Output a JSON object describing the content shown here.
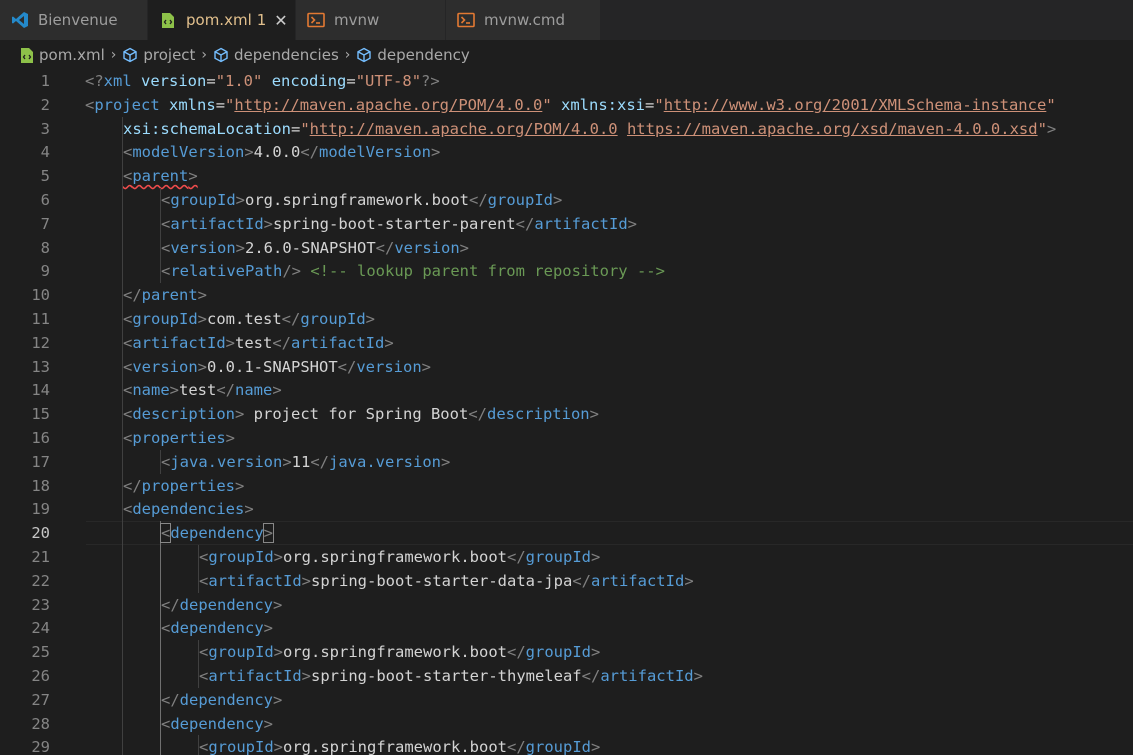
{
  "tabs": [
    {
      "name": "tab-bienvenue",
      "icon": "vscode-icon",
      "label": "Bienvenue",
      "active": false,
      "badge": "",
      "close": false,
      "width": 148
    },
    {
      "name": "tab-pom-xml",
      "icon": "xml-file-icon",
      "label": "pom.xml",
      "active": true,
      "badge": "1",
      "close": true,
      "width": 148
    },
    {
      "name": "tab-mvnw",
      "icon": "terminal-file-icon",
      "label": "mvnw",
      "active": false,
      "badge": "",
      "close": false,
      "width": 150
    },
    {
      "name": "tab-mvnw-cmd",
      "icon": "terminal-file-icon",
      "label": "mvnw.cmd",
      "active": false,
      "badge": "",
      "close": false,
      "width": 155
    }
  ],
  "breadcrumb": [
    {
      "icon": "xml-file-icon",
      "label": "pom.xml"
    },
    {
      "icon": "xml-element-icon",
      "label": "project"
    },
    {
      "icon": "xml-element-icon",
      "label": "dependencies"
    },
    {
      "icon": "xml-element-icon",
      "label": "dependency"
    }
  ],
  "colors": {
    "background": "#1e1e1e",
    "tag": "#569cd6",
    "attribute": "#9cdcfe",
    "string": "#ce9178",
    "comment": "#6a9955",
    "punctuation": "#808080",
    "text": "#d4d4d4",
    "modified_tab": "#e2c08d"
  },
  "editor": {
    "current_line": 20,
    "lines": [
      {
        "n": "1",
        "indent": 0,
        "tokens": [
          [
            "p",
            "<?"
          ],
          [
            "t",
            "xml"
          ],
          [
            "s",
            " "
          ],
          [
            "a",
            "version"
          ],
          [
            "x",
            "="
          ],
          [
            "s",
            "\"1.0\""
          ],
          [
            "x",
            " "
          ],
          [
            "a",
            "encoding"
          ],
          [
            "x",
            "="
          ],
          [
            "s",
            "\"UTF-8\""
          ],
          [
            "p",
            "?>"
          ]
        ]
      },
      {
        "n": "2",
        "indent": 0,
        "tokens": [
          [
            "p",
            "<"
          ],
          [
            "t",
            "project"
          ],
          [
            "x",
            " "
          ],
          [
            "a",
            "xmlns"
          ],
          [
            "x",
            "="
          ],
          [
            "s",
            "\""
          ],
          [
            "su",
            "http://maven.apache.org/POM/4.0.0"
          ],
          [
            "s",
            "\""
          ],
          [
            "x",
            " "
          ],
          [
            "a",
            "xmlns:xsi"
          ],
          [
            "x",
            "="
          ],
          [
            "s",
            "\""
          ],
          [
            "su",
            "http://www.w3.org/2001/XMLSchema-instance"
          ],
          [
            "s",
            "\""
          ]
        ]
      },
      {
        "n": "3",
        "indent": 1,
        "tokens": [
          [
            "a",
            "xsi:schemaLocation"
          ],
          [
            "x",
            "="
          ],
          [
            "s",
            "\""
          ],
          [
            "su",
            "http://maven.apache.org/POM/4.0.0"
          ],
          [
            "s",
            " "
          ],
          [
            "su",
            "https://maven.apache.org/xsd/maven-4.0.0.xsd"
          ],
          [
            "s",
            "\""
          ],
          [
            "p",
            ">"
          ]
        ]
      },
      {
        "n": "4",
        "indent": 1,
        "tokens": [
          [
            "p",
            "<"
          ],
          [
            "t",
            "modelVersion"
          ],
          [
            "p",
            ">"
          ],
          [
            "x",
            "4.0.0"
          ],
          [
            "p",
            "</"
          ],
          [
            "t",
            "modelVersion"
          ],
          [
            "p",
            ">"
          ]
        ]
      },
      {
        "n": "5",
        "indent": 1,
        "tokens": [
          [
            "pe",
            "<"
          ],
          [
            "te",
            "parent"
          ],
          [
            "pe",
            ">"
          ]
        ]
      },
      {
        "n": "6",
        "indent": 2,
        "tokens": [
          [
            "p",
            "<"
          ],
          [
            "t",
            "groupId"
          ],
          [
            "p",
            ">"
          ],
          [
            "x",
            "org.springframework.boot"
          ],
          [
            "p",
            "</"
          ],
          [
            "t",
            "groupId"
          ],
          [
            "p",
            ">"
          ]
        ]
      },
      {
        "n": "7",
        "indent": 2,
        "tokens": [
          [
            "p",
            "<"
          ],
          [
            "t",
            "artifactId"
          ],
          [
            "p",
            ">"
          ],
          [
            "x",
            "spring-boot-starter-parent"
          ],
          [
            "p",
            "</"
          ],
          [
            "t",
            "artifactId"
          ],
          [
            "p",
            ">"
          ]
        ]
      },
      {
        "n": "8",
        "indent": 2,
        "tokens": [
          [
            "p",
            "<"
          ],
          [
            "t",
            "version"
          ],
          [
            "p",
            ">"
          ],
          [
            "x",
            "2.6.0-SNAPSHOT"
          ],
          [
            "p",
            "</"
          ],
          [
            "t",
            "version"
          ],
          [
            "p",
            ">"
          ]
        ]
      },
      {
        "n": "9",
        "indent": 2,
        "tokens": [
          [
            "p",
            "<"
          ],
          [
            "t",
            "relativePath"
          ],
          [
            "p",
            "/>"
          ],
          [
            "x",
            " "
          ],
          [
            "c",
            "<!-- lookup parent from repository -->"
          ]
        ]
      },
      {
        "n": "10",
        "indent": 1,
        "tokens": [
          [
            "p",
            "</"
          ],
          [
            "t",
            "parent"
          ],
          [
            "p",
            ">"
          ]
        ]
      },
      {
        "n": "11",
        "indent": 1,
        "tokens": [
          [
            "p",
            "<"
          ],
          [
            "t",
            "groupId"
          ],
          [
            "p",
            ">"
          ],
          [
            "x",
            "com.test"
          ],
          [
            "p",
            "</"
          ],
          [
            "t",
            "groupId"
          ],
          [
            "p",
            ">"
          ]
        ]
      },
      {
        "n": "12",
        "indent": 1,
        "tokens": [
          [
            "p",
            "<"
          ],
          [
            "t",
            "artifactId"
          ],
          [
            "p",
            ">"
          ],
          [
            "x",
            "test"
          ],
          [
            "p",
            "</"
          ],
          [
            "t",
            "artifactId"
          ],
          [
            "p",
            ">"
          ]
        ]
      },
      {
        "n": "13",
        "indent": 1,
        "tokens": [
          [
            "p",
            "<"
          ],
          [
            "t",
            "version"
          ],
          [
            "p",
            ">"
          ],
          [
            "x",
            "0.0.1-SNAPSHOT"
          ],
          [
            "p",
            "</"
          ],
          [
            "t",
            "version"
          ],
          [
            "p",
            ">"
          ]
        ]
      },
      {
        "n": "14",
        "indent": 1,
        "tokens": [
          [
            "p",
            "<"
          ],
          [
            "t",
            "name"
          ],
          [
            "p",
            ">"
          ],
          [
            "x",
            "test"
          ],
          [
            "p",
            "</"
          ],
          [
            "t",
            "name"
          ],
          [
            "p",
            ">"
          ]
        ]
      },
      {
        "n": "15",
        "indent": 1,
        "tokens": [
          [
            "p",
            "<"
          ],
          [
            "t",
            "description"
          ],
          [
            "p",
            ">"
          ],
          [
            "x",
            " project for Spring Boot"
          ],
          [
            "p",
            "</"
          ],
          [
            "t",
            "description"
          ],
          [
            "p",
            ">"
          ]
        ]
      },
      {
        "n": "16",
        "indent": 1,
        "tokens": [
          [
            "p",
            "<"
          ],
          [
            "t",
            "properties"
          ],
          [
            "p",
            ">"
          ]
        ]
      },
      {
        "n": "17",
        "indent": 2,
        "tokens": [
          [
            "p",
            "<"
          ],
          [
            "t",
            "java.version"
          ],
          [
            "p",
            ">"
          ],
          [
            "x",
            "11"
          ],
          [
            "p",
            "</"
          ],
          [
            "t",
            "java.version"
          ],
          [
            "p",
            ">"
          ]
        ]
      },
      {
        "n": "18",
        "indent": 1,
        "tokens": [
          [
            "p",
            "</"
          ],
          [
            "t",
            "properties"
          ],
          [
            "p",
            ">"
          ]
        ]
      },
      {
        "n": "19",
        "indent": 1,
        "tokens": [
          [
            "p",
            "<"
          ],
          [
            "t",
            "dependencies"
          ],
          [
            "p",
            ">"
          ]
        ]
      },
      {
        "n": "20",
        "indent": 2,
        "tokens": [
          [
            "pb",
            "<"
          ],
          [
            "t",
            "dependency"
          ],
          [
            "pb",
            ">"
          ]
        ]
      },
      {
        "n": "21",
        "indent": 3,
        "tokens": [
          [
            "p",
            "<"
          ],
          [
            "t",
            "groupId"
          ],
          [
            "p",
            ">"
          ],
          [
            "x",
            "org.springframework.boot"
          ],
          [
            "p",
            "</"
          ],
          [
            "t",
            "groupId"
          ],
          [
            "p",
            ">"
          ]
        ]
      },
      {
        "n": "22",
        "indent": 3,
        "tokens": [
          [
            "p",
            "<"
          ],
          [
            "t",
            "artifactId"
          ],
          [
            "p",
            ">"
          ],
          [
            "x",
            "spring-boot-starter-data-jpa"
          ],
          [
            "p",
            "</"
          ],
          [
            "t",
            "artifactId"
          ],
          [
            "p",
            ">"
          ]
        ]
      },
      {
        "n": "23",
        "indent": 2,
        "tokens": [
          [
            "p",
            "</"
          ],
          [
            "t",
            "dependency"
          ],
          [
            "p",
            ">"
          ]
        ]
      },
      {
        "n": "24",
        "indent": 2,
        "tokens": [
          [
            "p",
            "<"
          ],
          [
            "t",
            "dependency"
          ],
          [
            "p",
            ">"
          ]
        ]
      },
      {
        "n": "25",
        "indent": 3,
        "tokens": [
          [
            "p",
            "<"
          ],
          [
            "t",
            "groupId"
          ],
          [
            "p",
            ">"
          ],
          [
            "x",
            "org.springframework.boot"
          ],
          [
            "p",
            "</"
          ],
          [
            "t",
            "groupId"
          ],
          [
            "p",
            ">"
          ]
        ]
      },
      {
        "n": "26",
        "indent": 3,
        "tokens": [
          [
            "p",
            "<"
          ],
          [
            "t",
            "artifactId"
          ],
          [
            "p",
            ">"
          ],
          [
            "x",
            "spring-boot-starter-thymeleaf"
          ],
          [
            "p",
            "</"
          ],
          [
            "t",
            "artifactId"
          ],
          [
            "p",
            ">"
          ]
        ]
      },
      {
        "n": "27",
        "indent": 2,
        "tokens": [
          [
            "p",
            "</"
          ],
          [
            "t",
            "dependency"
          ],
          [
            "p",
            ">"
          ]
        ]
      },
      {
        "n": "28",
        "indent": 2,
        "tokens": [
          [
            "p",
            "<"
          ],
          [
            "t",
            "dependency"
          ],
          [
            "p",
            ">"
          ]
        ]
      },
      {
        "n": "29",
        "indent": 3,
        "tokens": [
          [
            "p",
            "<"
          ],
          [
            "t",
            "groupId"
          ],
          [
            "p",
            ">"
          ],
          [
            "x",
            "org.springframework.boot"
          ],
          [
            "p",
            "</"
          ],
          [
            "t",
            "groupId"
          ],
          [
            "p",
            ">"
          ]
        ]
      }
    ]
  }
}
